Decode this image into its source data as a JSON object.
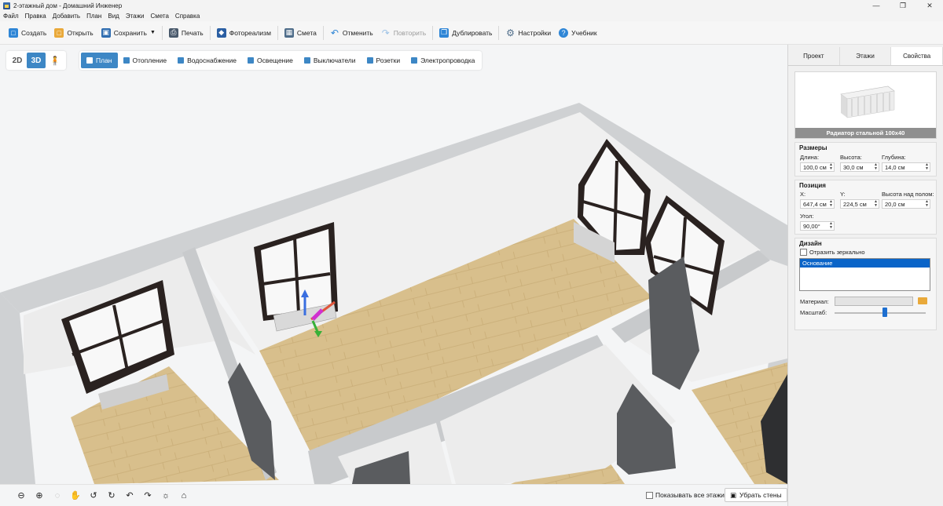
{
  "window": {
    "title": "2-этажный дом - Домашний Инженер"
  },
  "menu": [
    "Файл",
    "Правка",
    "Добавить",
    "План",
    "Вид",
    "Этажи",
    "Смета",
    "Справка"
  ],
  "toolbar": {
    "create": "Создать",
    "open": "Открыть",
    "save": "Сохранить",
    "print": "Печать",
    "photorealism": "Фотореализм",
    "estimate": "Смета",
    "undo": "Отменить",
    "redo": "Повторить",
    "duplicate": "Дублировать",
    "settings": "Настройки",
    "tutorial": "Учебник"
  },
  "view_modes": {
    "mode_2d": "2D",
    "mode_3d": "3D",
    "active": "3D"
  },
  "layers": [
    "План",
    "Отопление",
    "Водоснабжение",
    "Освещение",
    "Выключатели",
    "Розетки",
    "Электропроводка"
  ],
  "bottom": {
    "show_all_floors": "Показывать все этажи",
    "remove_walls": "Убрать стены"
  },
  "panel": {
    "tabs": [
      "Проект",
      "Этажи",
      "Свойства"
    ],
    "active_tab": "Свойства",
    "object_name": "Радиатор стальной 100x40",
    "sizes": {
      "title": "Размеры",
      "length_label": "Длина:",
      "length": "100,0 см",
      "height_label": "Высота:",
      "height": "30,0 см",
      "depth_label": "Глубина:",
      "depth": "14,0 см"
    },
    "position": {
      "title": "Позиция",
      "x_label": "X:",
      "x": "647,4 см",
      "y_label": "Y:",
      "y": "224,5 см",
      "elev_label": "Высота над полом:",
      "elev": "20,0 см",
      "angle_label": "Угол:",
      "angle": "90,00°"
    },
    "design": {
      "title": "Дизайн",
      "mirror_label": "Отразить зеркально",
      "items": [
        "Основание"
      ],
      "material_label": "Материал:",
      "scale_label": "Масштаб:",
      "scale_value": 0.55
    }
  },
  "colors": {
    "accent": "#3d87c5",
    "floor": "#d6bb87",
    "wall": "#e9e9e9",
    "selection": "#0a64c8"
  }
}
